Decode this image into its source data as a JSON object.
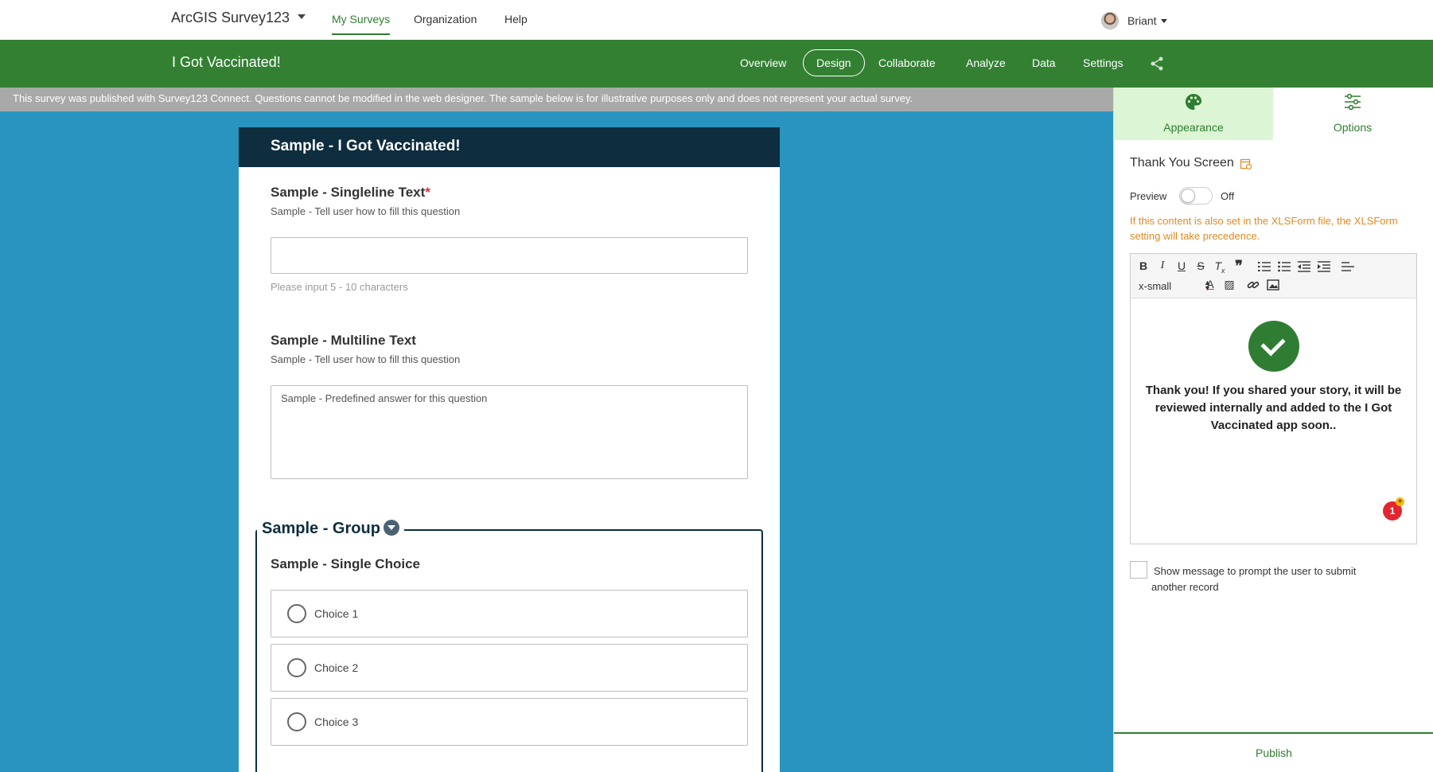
{
  "topnav": {
    "brand": "ArcGIS Survey123",
    "links": [
      "My Surveys",
      "Organization",
      "Help"
    ],
    "user": "Briant"
  },
  "survey": {
    "title": "I Got Vaccinated!",
    "tabs": [
      "Overview",
      "Design",
      "Collaborate",
      "Analyze",
      "Data",
      "Settings"
    ],
    "active_tab": "Design"
  },
  "infobar": "This survey was published with Survey123 Connect. Questions cannot be modified in the web designer. The sample below is for illustrative purposes only and does not represent your actual survey.",
  "form": {
    "header": "Sample - I Got Vaccinated!",
    "q1": {
      "title": "Sample - Singleline Text",
      "required_mark": "*",
      "hint": "Sample - Tell user how to fill this question",
      "help": "Please input 5 - 10 characters"
    },
    "q2": {
      "title": "Sample - Multiline Text",
      "hint": "Sample - Tell user how to fill this question",
      "value": "Sample - Predefined answer for this question"
    },
    "group": {
      "title": "Sample - Group",
      "q3_title": "Sample - Single Choice",
      "choices": [
        "Choice 1",
        "Choice 2",
        "Choice 3"
      ]
    }
  },
  "panel": {
    "tabs": [
      "Appearance",
      "Options"
    ],
    "section_title": "Thank You Screen",
    "preview_label": "Preview",
    "preview_state": "Off",
    "warning": "If this content is also set in the XLSForm file, the XLSForm setting will take precedence.",
    "editor": {
      "font_size": "x-small",
      "toolbar_row1": [
        "B",
        "I",
        "U",
        "S",
        "Tx",
        "❞",
        "list-ordered",
        "list-bulleted",
        "outdent",
        "indent",
        "align"
      ],
      "message": "Thank you! If you shared your story, it will be reviewed internally and added to the I Got Vaccinated app soon..",
      "badge_count": "1"
    },
    "checkbox_label_1": "Show message to prompt the user to submit",
    "checkbox_label_2": "another record",
    "publish": "Publish"
  },
  "colors": {
    "green": "#338033",
    "canvas_blue": "#2994c0",
    "form_header": "#0e2d3f",
    "warning": "#e08a25"
  }
}
